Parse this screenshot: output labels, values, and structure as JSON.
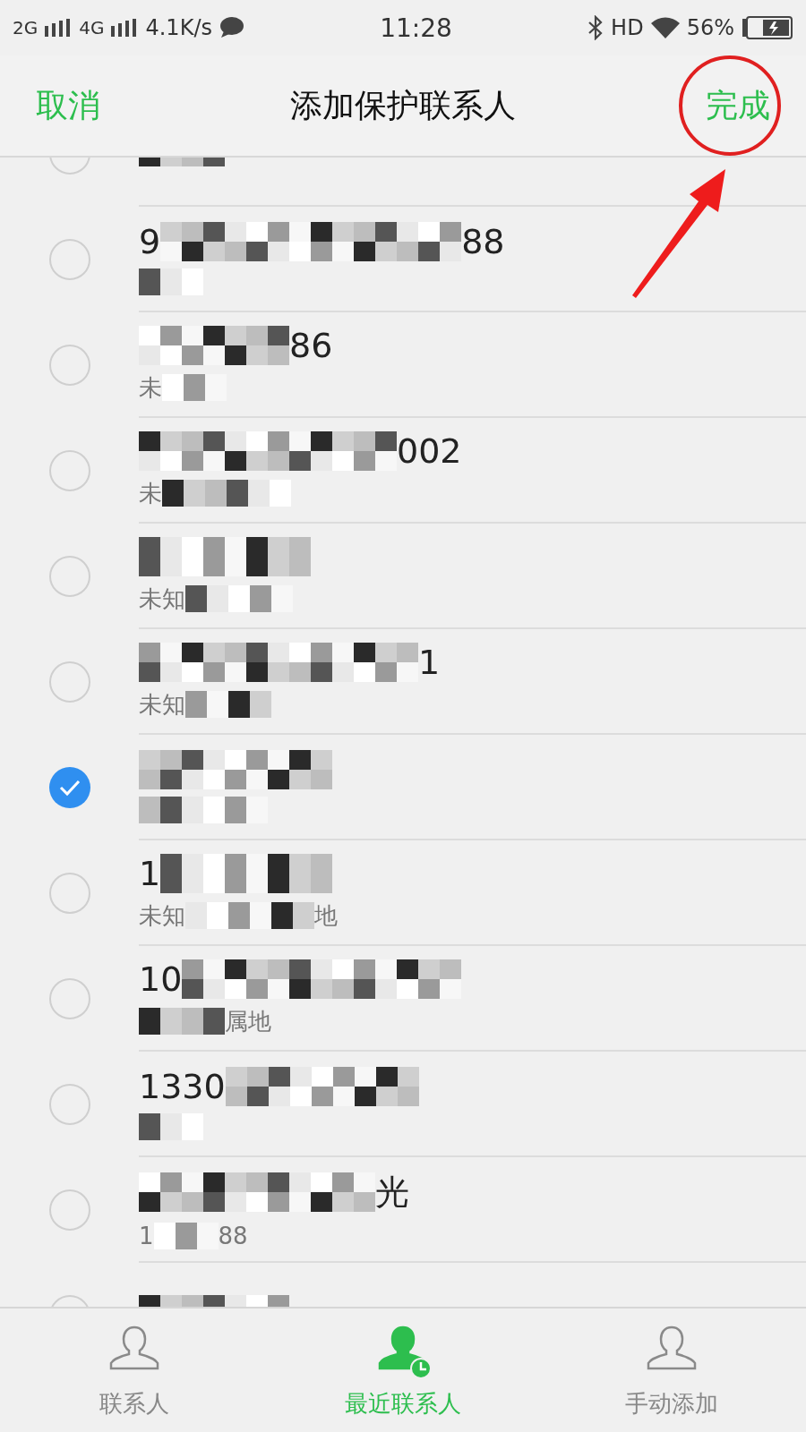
{
  "status_bar": {
    "signal_1": "2G",
    "signal_2": "4G",
    "speed": "4.1K/s",
    "time": "11:28",
    "hd": "HD",
    "battery": "56%"
  },
  "nav": {
    "cancel": "取消",
    "title": "添加保护联系人",
    "done": "完成"
  },
  "rows": [
    {
      "checked": false,
      "primary": [],
      "secondary": [
        {
          "kind": "mosaic"
        }
      ]
    },
    {
      "checked": false,
      "primary": [
        {
          "kind": "text",
          "text": "9"
        },
        {
          "kind": "mosaic"
        },
        {
          "kind": "text",
          "text": "88"
        }
      ],
      "secondary": [
        {
          "kind": "mosaic"
        }
      ]
    },
    {
      "checked": false,
      "primary": [
        {
          "kind": "mosaic"
        },
        {
          "kind": "text",
          "text": "86"
        }
      ],
      "secondary": [
        {
          "kind": "text",
          "text": "未"
        },
        {
          "kind": "mosaic"
        }
      ]
    },
    {
      "checked": false,
      "primary": [
        {
          "kind": "mosaic"
        },
        {
          "kind": "text",
          "text": "002"
        }
      ],
      "secondary": [
        {
          "kind": "text",
          "text": "未"
        },
        {
          "kind": "mosaic"
        }
      ]
    },
    {
      "checked": false,
      "primary": [
        {
          "kind": "mosaic"
        }
      ],
      "secondary": [
        {
          "kind": "text",
          "text": "未知"
        },
        {
          "kind": "mosaic"
        }
      ]
    },
    {
      "checked": false,
      "primary": [
        {
          "kind": "mosaic"
        },
        {
          "kind": "text",
          "text": "1"
        }
      ],
      "secondary": [
        {
          "kind": "text",
          "text": "未知"
        },
        {
          "kind": "mosaic"
        }
      ]
    },
    {
      "checked": true,
      "primary": [
        {
          "kind": "mosaic"
        }
      ],
      "secondary": [
        {
          "kind": "mosaic"
        }
      ]
    },
    {
      "checked": false,
      "primary": [
        {
          "kind": "text",
          "text": "1"
        },
        {
          "kind": "mosaic"
        }
      ],
      "secondary": [
        {
          "kind": "text",
          "text": "未知"
        },
        {
          "kind": "mosaic"
        },
        {
          "kind": "text",
          "text": "地"
        }
      ]
    },
    {
      "checked": false,
      "primary": [
        {
          "kind": "text",
          "text": "10"
        },
        {
          "kind": "mosaic"
        }
      ],
      "secondary": [
        {
          "kind": "mosaic"
        },
        {
          "kind": "text",
          "text": "属地"
        }
      ]
    },
    {
      "checked": false,
      "primary": [
        {
          "kind": "text",
          "text": "1330"
        },
        {
          "kind": "mosaic"
        }
      ],
      "secondary": [
        {
          "kind": "mosaic"
        }
      ]
    },
    {
      "checked": false,
      "primary": [
        {
          "kind": "mosaic"
        },
        {
          "kind": "text",
          "text": "光"
        }
      ],
      "secondary": [
        {
          "kind": "text",
          "text": "1"
        },
        {
          "kind": "mosaic"
        },
        {
          "kind": "text",
          "text": "88"
        }
      ]
    },
    {
      "checked": false,
      "primary": [
        {
          "kind": "mosaic"
        }
      ],
      "secondary": []
    }
  ],
  "tabs": [
    {
      "label": "联系人",
      "selected": false,
      "kind": "person"
    },
    {
      "label": "最近联系人",
      "selected": true,
      "kind": "recent"
    },
    {
      "label": "手动添加",
      "selected": false,
      "kind": "add"
    }
  ]
}
